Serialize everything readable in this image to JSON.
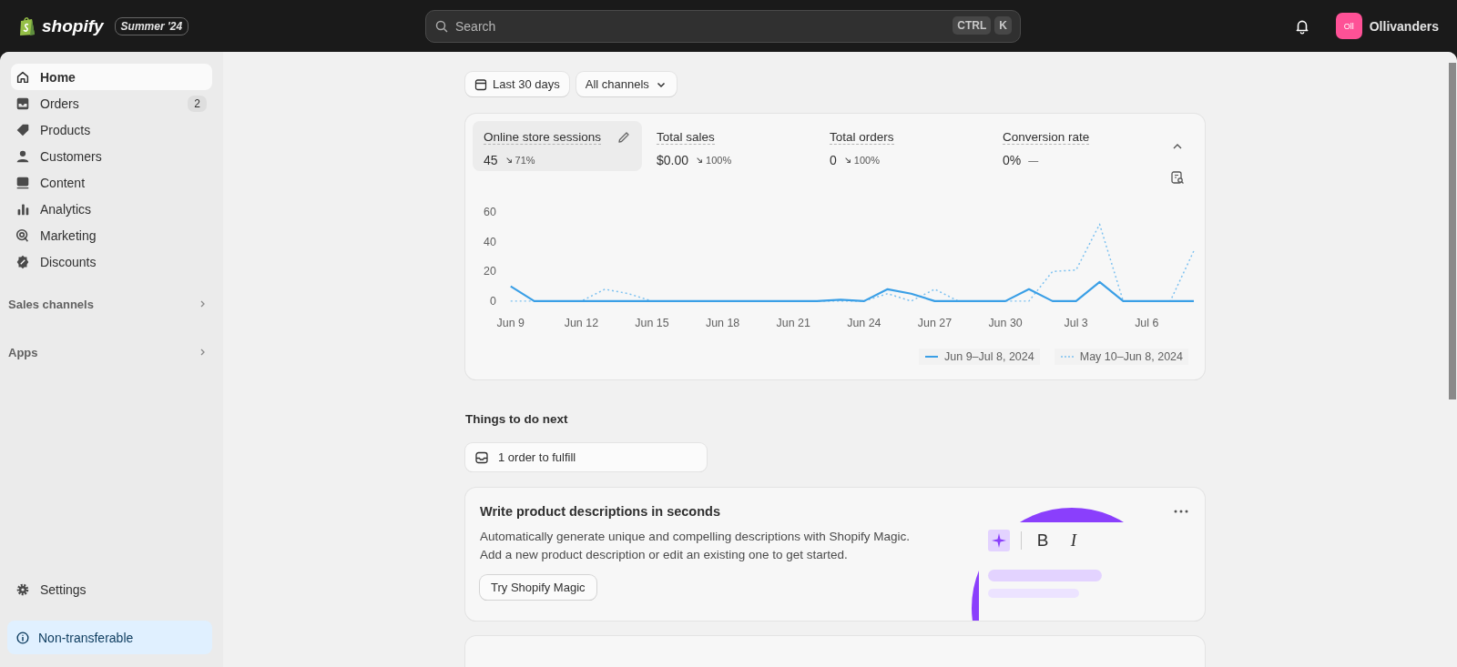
{
  "topbar": {
    "logo": "shopify",
    "edition": "Summer '24",
    "search": {
      "placeholder": "Search",
      "keys": [
        "CTRL",
        "K"
      ]
    },
    "store": {
      "initials": "Oll",
      "name": "Ollivanders"
    }
  },
  "sidebar": {
    "items": [
      {
        "label": "Home",
        "selected": true
      },
      {
        "label": "Orders",
        "selected": false,
        "badge": "2"
      },
      {
        "label": "Products",
        "selected": false
      },
      {
        "label": "Customers",
        "selected": false
      },
      {
        "label": "Content",
        "selected": false
      },
      {
        "label": "Analytics",
        "selected": false
      },
      {
        "label": "Marketing",
        "selected": false
      },
      {
        "label": "Discounts",
        "selected": false
      }
    ],
    "sections": [
      "Sales channels",
      "Apps"
    ],
    "settings": "Settings",
    "notice": "Non-transferable"
  },
  "filters": {
    "date": "Last 30 days",
    "channel": "All channels"
  },
  "metrics": [
    {
      "label": "Online store sessions",
      "value": "45",
      "change": "71%",
      "kind": "down",
      "selected": true
    },
    {
      "label": "Total sales",
      "value": "$0.00",
      "change": "100%",
      "kind": "down",
      "selected": false
    },
    {
      "label": "Total orders",
      "value": "0",
      "change": "100%",
      "kind": "down",
      "selected": false
    },
    {
      "label": "Conversion rate",
      "value": "0%",
      "change": "—",
      "kind": "flat",
      "selected": false
    }
  ],
  "chart_data": {
    "type": "line",
    "categories": [
      "Jun 9",
      null,
      null,
      "Jun 12",
      null,
      null,
      "Jun 15",
      null,
      null,
      "Jun 18",
      null,
      null,
      "Jun 21",
      null,
      null,
      "Jun 24",
      null,
      null,
      "Jun 27",
      null,
      null,
      "Jun 30",
      null,
      null,
      "Jul 3",
      null,
      null,
      "Jul 6",
      null,
      null
    ],
    "series": [
      {
        "name": "Jun 9–Jul 8, 2024",
        "color": "#3a9fe6",
        "line_style": "solid",
        "values": [
          10,
          0,
          0,
          0,
          0,
          0,
          0,
          0,
          0,
          0,
          0,
          0,
          0,
          0,
          1,
          0,
          8,
          5,
          0,
          0,
          0,
          0,
          8,
          0,
          0,
          13,
          0,
          0,
          0,
          0
        ]
      },
      {
        "name": "May 10–Jun 8, 2024",
        "color": "#7cc1f0",
        "line_style": "dotted",
        "values": [
          0,
          0,
          0,
          0,
          8,
          5,
          0,
          0,
          0,
          0,
          0,
          0,
          0,
          0,
          0,
          0,
          5,
          0,
          8,
          0,
          0,
          0,
          0,
          20,
          21,
          52,
          0,
          0,
          0,
          34
        ]
      }
    ],
    "ylim": [
      0,
      60
    ],
    "yticks": [
      0,
      20,
      40,
      60
    ],
    "legend": "bottom-right"
  },
  "todo": {
    "title": "Things to do next",
    "task": "1 order to fulfill"
  },
  "magic_card": {
    "title": "Write product descriptions in seconds",
    "lines": [
      "Automatically generate unique and compelling descriptions with Shopify Magic.",
      "Add a new product description or edit an existing one to get started."
    ],
    "button": "Try Shopify Magic",
    "toolbar": [
      "B",
      "I"
    ]
  }
}
